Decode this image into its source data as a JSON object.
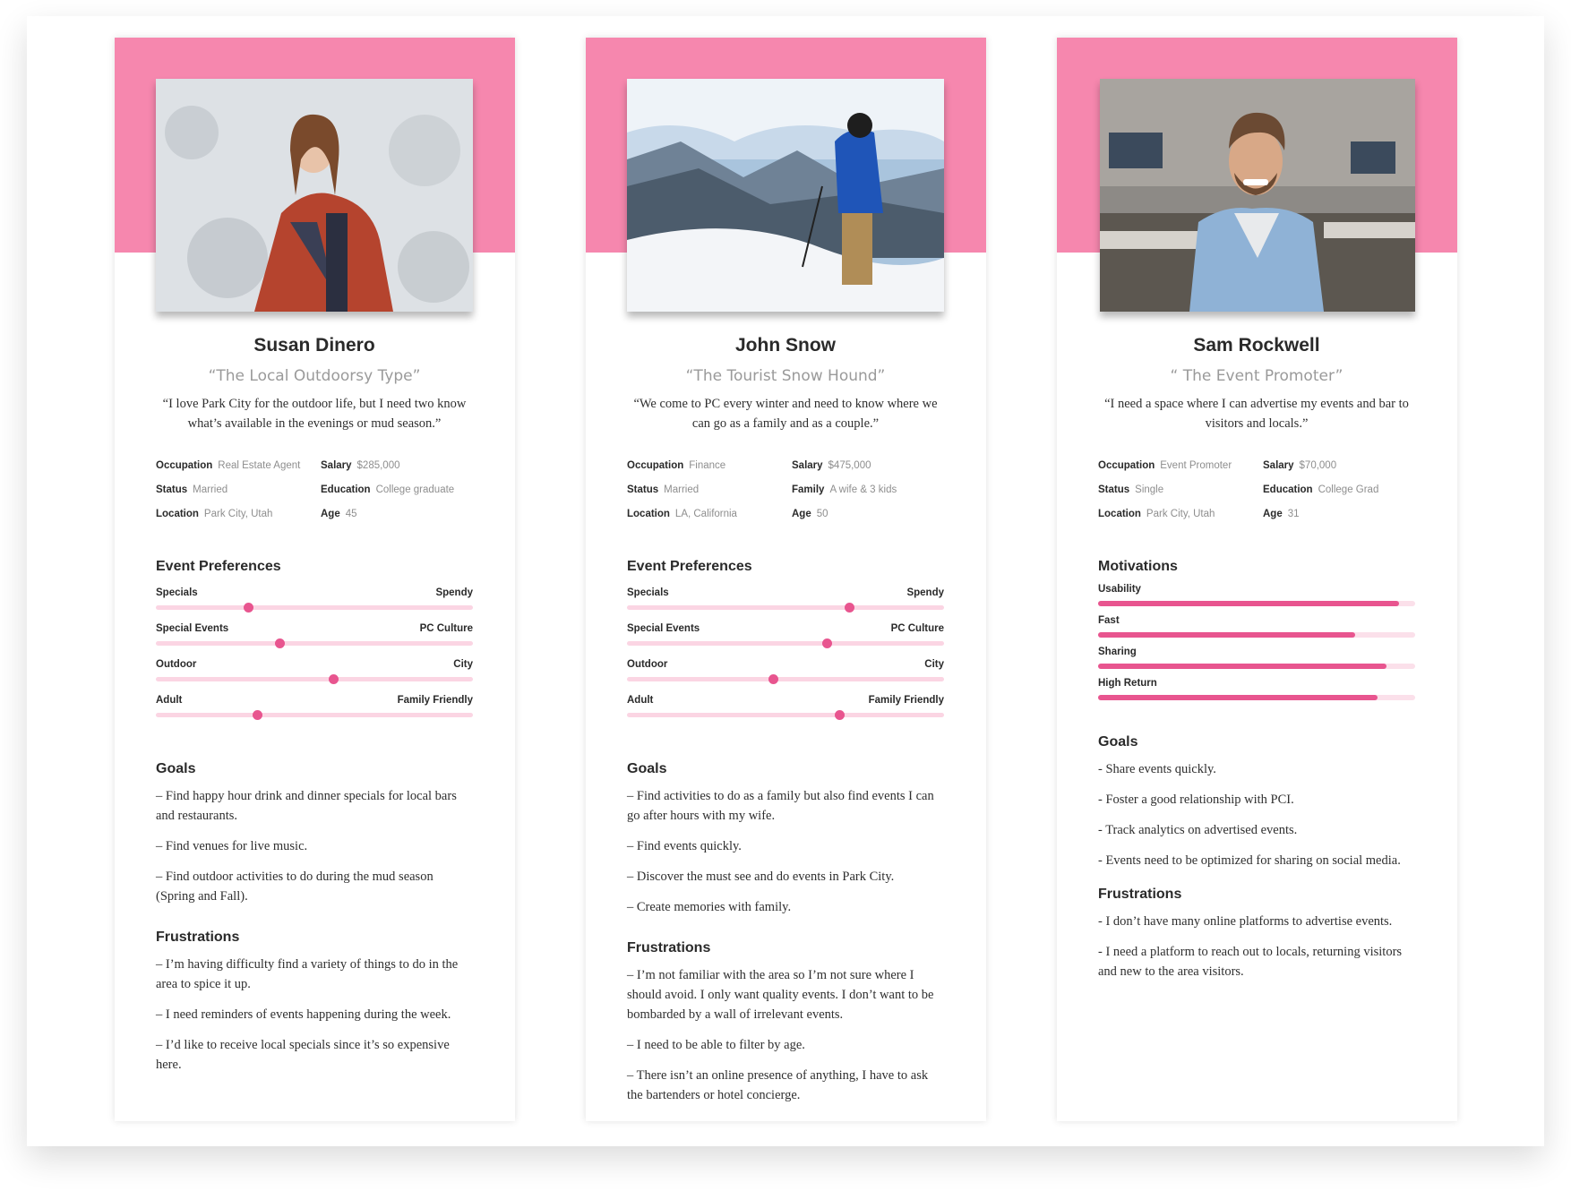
{
  "colors": {
    "accent": "#f687ae",
    "slider_knob": "#e8558f",
    "track": "#fbd5e3"
  },
  "personas": [
    {
      "name": "Susan Dinero",
      "tagline": "“The Local Outdoorsy Type”",
      "quote": "“I love Park City for the outdoor life, but I need two know what’s available in the evenings or mud season.”",
      "facts": [
        {
          "key": "Occupation",
          "value": "Real Estate Agent"
        },
        {
          "key": "Salary",
          "value": "$285,000"
        },
        {
          "key": "Status",
          "value": "Married"
        },
        {
          "key": "Education",
          "value": "College graduate"
        },
        {
          "key": "Location",
          "value": "Park City, Utah"
        },
        {
          "key": "Age",
          "value": "45"
        }
      ],
      "section": "Event Preferences",
      "preferences": [
        {
          "left": "Specials",
          "right": "Spendy",
          "position": 0.29
        },
        {
          "left": "Special Events",
          "right": "PC Culture",
          "position": 0.39
        },
        {
          "left": "Outdoor",
          "right": "City",
          "position": 0.56
        },
        {
          "left": "Adult",
          "right": "Family Friendly",
          "position": 0.32
        }
      ],
      "goals_title": "Goals",
      "goals": [
        "– Find happy hour drink and dinner specials for local bars and restaurants.",
        "– Find venues for live music.",
        "– Find outdoor activities to do during the mud season (Spring and Fall)."
      ],
      "frustrations_title": "Frustrations",
      "frustrations": [
        "– I’m having difficulty find a variety of things to do in the area to spice it up.",
        " – I need reminders of events happening during the week.",
        "– I’d like to receive local specials since it’s so expensive here."
      ]
    },
    {
      "name": "John Snow",
      "tagline": "“The Tourist Snow Hound”",
      "quote": "“We come to PC every winter and need to know where we can go as a family and as a couple.”",
      "facts": [
        {
          "key": "Occupation",
          "value": "Finance"
        },
        {
          "key": "Salary",
          "value": "$475,000"
        },
        {
          "key": "Status",
          "value": "Married"
        },
        {
          "key": "Family",
          "value": "A wife & 3 kids"
        },
        {
          "key": "Location",
          "value": "LA, California"
        },
        {
          "key": "Age",
          "value": "50"
        }
      ],
      "section": "Event Preferences",
      "preferences": [
        {
          "left": "Specials",
          "right": "Spendy",
          "position": 0.7
        },
        {
          "left": "Special Events",
          "right": "PC Culture",
          "position": 0.63
        },
        {
          "left": "Outdoor",
          "right": "City",
          "position": 0.46
        },
        {
          "left": "Adult",
          "right": "Family Friendly",
          "position": 0.67
        }
      ],
      "goals_title": "Goals",
      "goals": [
        "– Find activities to do as a family but also find events I can go after hours with my wife.",
        "– Find events quickly.",
        "– Discover the must see and do events in Park City.",
        "– Create memories with family."
      ],
      "frustrations_title": "Frustrations",
      "frustrations": [
        "– I’m not familiar with the area so I’m not sure where I should avoid. I only want quality events. I don’t want to be bombarded by a wall of irrelevant events.",
        "– I need to be able to filter by age.",
        "– There isn’t an online presence of anything, I have to ask the bartenders or hotel concierge."
      ]
    },
    {
      "name": "Sam Rockwell",
      "tagline": "“ The Event Promoter”",
      "quote": "“I need a space where I can advertise my events and bar to visitors and locals.”",
      "facts": [
        {
          "key": "Occupation",
          "value": "Event Promoter"
        },
        {
          "key": "Salary",
          "value": "$70,000"
        },
        {
          "key": "Status",
          "value": "Single"
        },
        {
          "key": "Education",
          "value": "College Grad"
        },
        {
          "key": "Location",
          "value": "Park City, Utah"
        },
        {
          "key": "Age",
          "value": "31"
        }
      ],
      "section": "Motivations",
      "motivations": [
        {
          "label": "Usability",
          "level": 0.95
        },
        {
          "label": "Fast",
          "level": 0.81
        },
        {
          "label": "Sharing",
          "level": 0.91
        },
        {
          "label": "High Return",
          "level": 0.88
        }
      ],
      "goals_title": "Goals",
      "goals": [
        "- Share events quickly.",
        "- Foster a good relationship with PCI.",
        "- Track analytics on advertised events.",
        "- Events need to be optimized for sharing on social media."
      ],
      "frustrations_title": "Frustrations",
      "frustrations": [
        "- I don’t have many online platforms to advertise events.",
        "- I need a platform to reach out to locals, returning visitors and new to the area visitors."
      ]
    }
  ]
}
